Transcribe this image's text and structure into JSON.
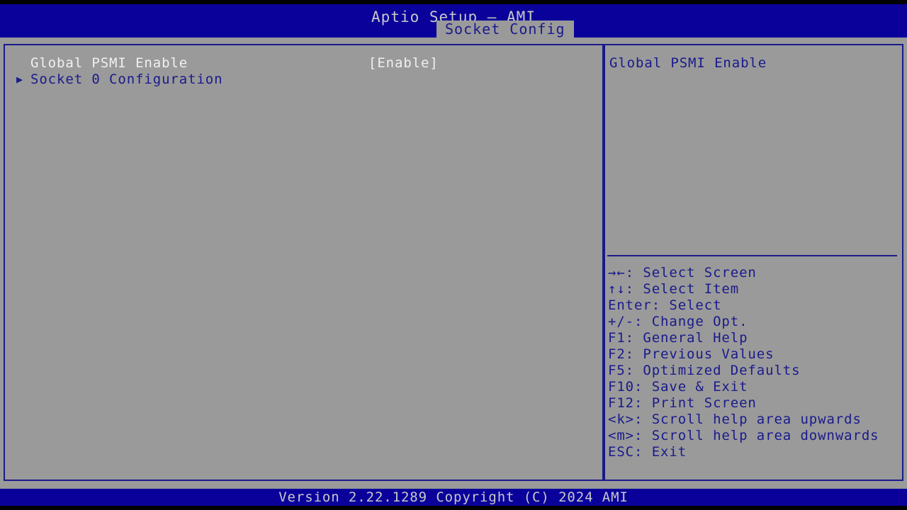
{
  "app": {
    "title": "Aptio Setup – AMI",
    "version_bar": "Version 2.22.1289 Copyright (C) 2024 AMI"
  },
  "colors": {
    "blue": "#0a019b",
    "text_blue": "#1a1a8c",
    "gray_bg": "#9a9a9a",
    "white_text": "#f0f0f0",
    "title_text": "#c8c8c8",
    "black": "#000000"
  },
  "tabs": [
    {
      "label": "Socket Config",
      "active": true
    }
  ],
  "main": {
    "rows": [
      {
        "arrow": "",
        "label": "Global PSMI Enable",
        "value": "[Enable]",
        "style": "white",
        "selected": true
      },
      {
        "arrow": "▶",
        "label": "Socket 0 Configuration",
        "value": "",
        "style": "blue",
        "selected": false
      }
    ]
  },
  "help": {
    "description": "Global PSMI Enable",
    "hotkeys": [
      "→←: Select Screen",
      "↑↓: Select Item",
      "Enter: Select",
      "+/-: Change Opt.",
      "F1: General Help",
      "F2: Previous Values",
      "F5: Optimized Defaults",
      "F10: Save & Exit",
      "F12: Print Screen",
      "<k>: Scroll help area upwards",
      "<m>: Scroll help area downwards",
      "ESC: Exit"
    ]
  }
}
